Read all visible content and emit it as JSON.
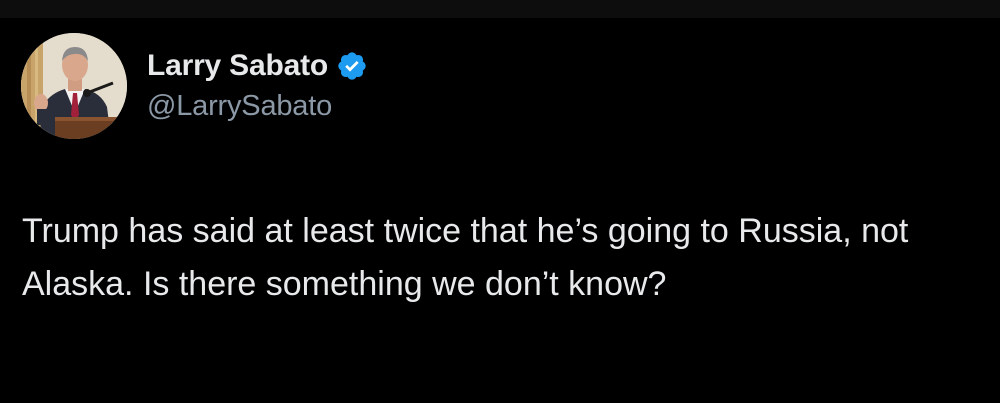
{
  "author": {
    "display_name": "Larry Sabato",
    "handle": "@LarrySabato",
    "verified": true,
    "verified_color": "#1d9bf0"
  },
  "tweet": {
    "text": "Trump has said at least twice that he’s going to Russia, not Alaska. Is there something we don’t know?"
  },
  "icons": {
    "verified": "verified-badge-icon"
  },
  "colors": {
    "background": "#000000",
    "primary_text": "#e7e9ea",
    "secondary_text": "#8b98a5"
  }
}
